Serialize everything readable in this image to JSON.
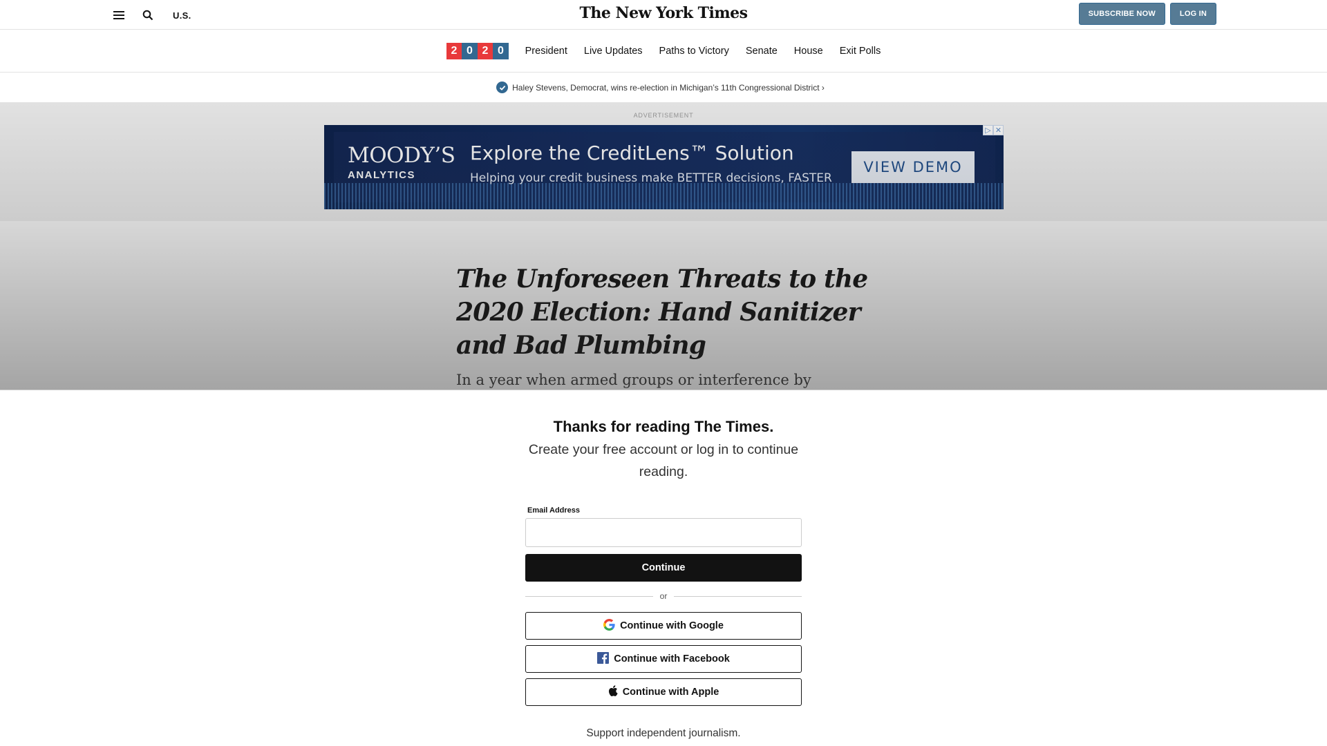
{
  "masthead": {
    "section": "U.S.",
    "logo": "The New York Times",
    "subscribe_label": "SUBSCRIBE NOW",
    "login_label": "LOG IN",
    "icons": [
      "menu-icon",
      "search-icon"
    ]
  },
  "election_nav": {
    "badge_digits": [
      "2",
      "0",
      "2",
      "0"
    ],
    "badge_colors": [
      "#e8393b",
      "#326891",
      "#e8393b",
      "#326891"
    ],
    "links": [
      "President",
      "Live Updates",
      "Paths to Victory",
      "Senate",
      "House",
      "Exit Polls"
    ]
  },
  "ticker": {
    "text": "Haley Stevens, Democrat, wins re-election in Michigan’s 11th Congressional District ›"
  },
  "ad": {
    "label": "ADVERTISEMENT",
    "brand": "MOODY’S",
    "brand_sub": "ANALYTICS",
    "headline": "Explore the CreditLens™ Solution",
    "subline": "Helping your credit business make BETTER decisions, FASTER",
    "cta": "VIEW DEMO"
  },
  "article": {
    "headline": "The Unforeseen Threats to the 2020 Election: Hand Sanitizer and Bad Plumbing",
    "summary": "In a year when armed groups or interference by foreign"
  },
  "modal": {
    "title": "Thanks for reading The Times.",
    "subtitle": "Create your free account or log in to continue reading.",
    "email_label": "Email Address",
    "email_value": "",
    "continue_label": "Continue",
    "or_label": "or",
    "google_label": "Continue with Google",
    "facebook_label": "Continue with Facebook",
    "apple_label": "Continue with Apple",
    "support_text": "Support independent journalism."
  },
  "colors": {
    "accent_blue": "#326891",
    "button_blue": "#567b95",
    "accent_red": "#e8393b"
  }
}
